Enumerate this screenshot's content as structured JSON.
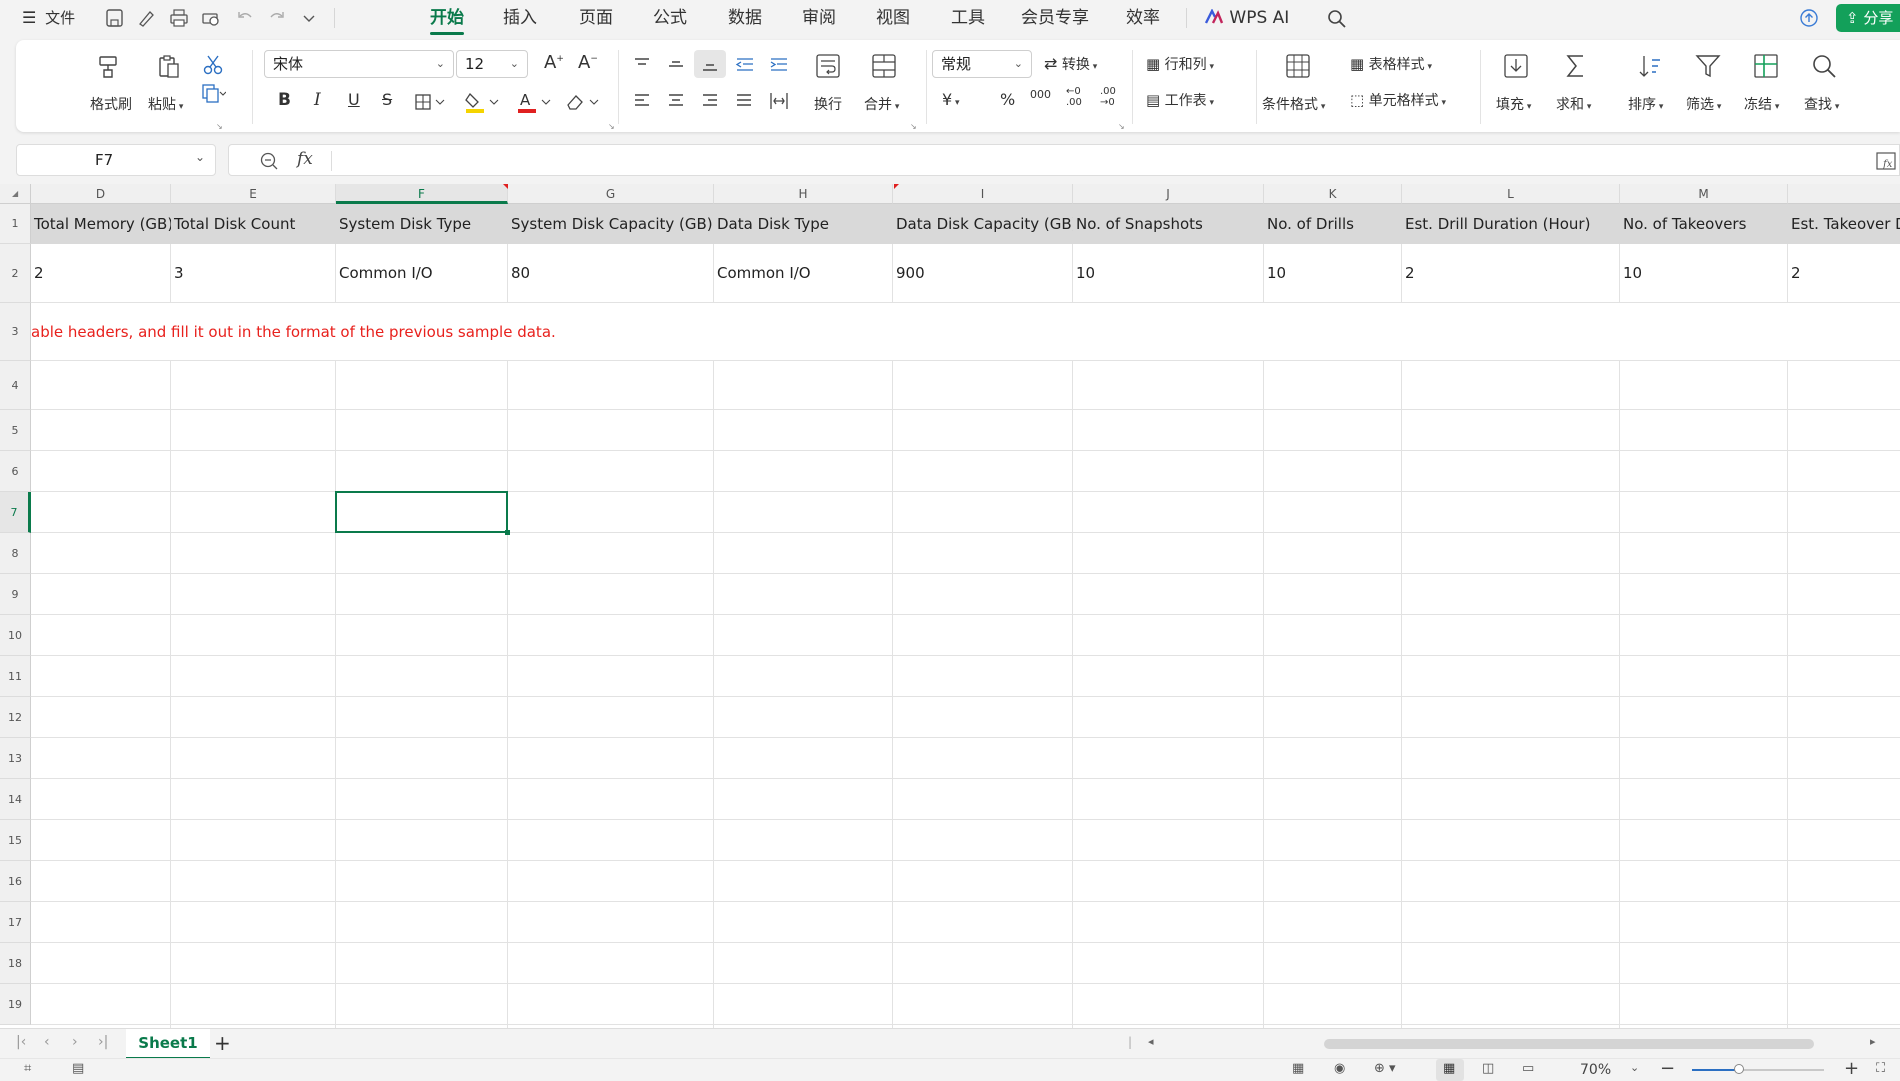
{
  "menu": {
    "file_label": "文件",
    "tabs": [
      "开始",
      "插入",
      "页面",
      "公式",
      "数据",
      "审阅",
      "视图",
      "工具",
      "会员专享",
      "效率"
    ],
    "wps_ai_label": "WPS AI",
    "share_label": "分享"
  },
  "ribbon": {
    "format_painter": "格式刷",
    "paste": "粘贴",
    "font_name": "宋体",
    "font_size": "12",
    "wrap": "换行",
    "merge": "合并",
    "number_format": "常规",
    "convert": "转换",
    "rows_cols": "行和列",
    "worksheet": "工作表",
    "cond_format": "条件格式",
    "table_style": "表格样式",
    "cell_style": "单元格样式",
    "fill": "填充",
    "sum": "求和",
    "sort": "排序",
    "filter": "筛选",
    "freeze": "冻结",
    "find": "查找",
    "currency_symbol": "¥",
    "percent_symbol": "%",
    "thousands_symbol": "000"
  },
  "formula_bar": {
    "cell_ref": "F7",
    "fx_label": "fx",
    "content": ""
  },
  "grid": {
    "columns": [
      "D",
      "E",
      "F",
      "G",
      "H",
      "I",
      "J",
      "K",
      "L",
      "M",
      ""
    ],
    "row_numbers": [
      "1",
      "2",
      "3",
      "4",
      "5",
      "6",
      "7",
      "8",
      "9",
      "10",
      "11",
      "12",
      "13",
      "14",
      "15",
      "16",
      "17",
      "18",
      "19"
    ],
    "headers": [
      "Total Memory (GB)",
      "Total Disk Count",
      "System Disk Type",
      "System Disk Capacity (GB)",
      "Data Disk Type",
      "Data Disk Capacity (GB)",
      "No. of Snapshots",
      "No. of Drills",
      "Est. Drill Duration (Hour)",
      "No. of Takeovers",
      "Est. Takeover Du"
    ],
    "sample_row": [
      "2",
      "3",
      "Common I/O",
      "80",
      "Common I/O",
      "900",
      "10",
      "10",
      "2",
      "10",
      "2"
    ],
    "note": "able headers, and fill it out in the format of the previous sample data.",
    "note_color": "#e8211d",
    "selected_cell": "F7",
    "accent_color": "#0a7a4b"
  },
  "sheets": {
    "active": "Sheet1"
  },
  "status": {
    "zoom": "70%"
  }
}
